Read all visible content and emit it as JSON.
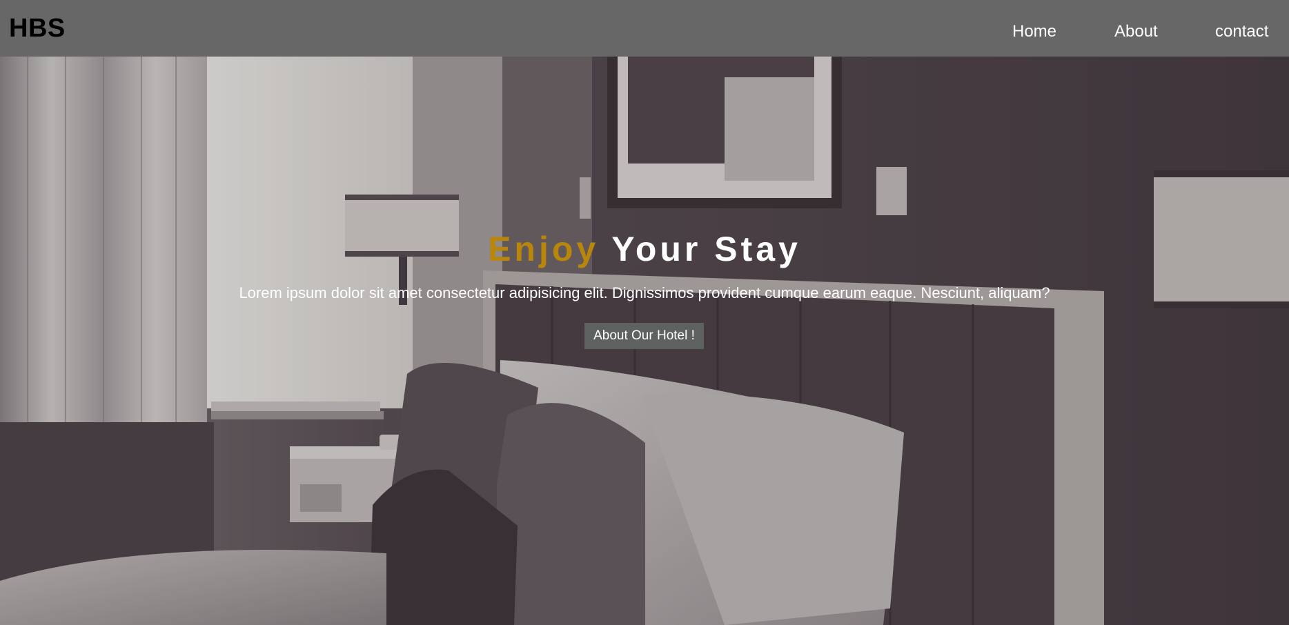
{
  "brand": "HBS",
  "nav": {
    "home": "Home",
    "about": "About",
    "contact": "contact"
  },
  "hero": {
    "title_accent": "Enjoy",
    "title_rest": " Your Stay",
    "subtitle": "Lorem ipsum dolor sit amet consectetur adipisicing elit. Dignissimos provident cumque earum eaque. Nesciunt, aliquam?",
    "button_label": "About Our Hotel !",
    "background_image": "hotel-room-photo"
  },
  "colors": {
    "navbar_bg": "#676767",
    "accent": "#b8860b",
    "button_bg": "#5d6160"
  }
}
